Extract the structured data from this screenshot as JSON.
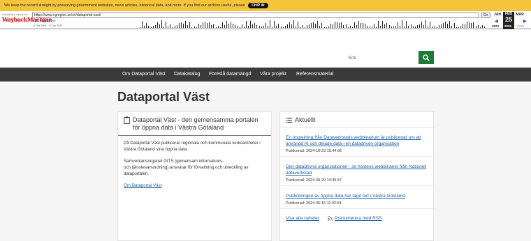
{
  "wayback": {
    "banner_text": "We keep the record straight by preserving government websites, news articles, historical data, and more. If you find our archive useful, please",
    "chip_label": "CHIP IN",
    "logo_top": "INTERNET ARCHIVE",
    "logo_main": "WaybackMachine",
    "url": "https://www.vgregion.se/ov/dataportal-vast/",
    "go_label": "Go",
    "captures": "787 captures",
    "date_range": "11 Okt 2009 – 27 Jun 2025",
    "months": [
      "JAN",
      "FEB",
      "MAR"
    ],
    "current_day": "25",
    "years": [
      "2023",
      "2025",
      "2026"
    ]
  },
  "header": {
    "search_placeholder": "Sök"
  },
  "nav": {
    "items": [
      {
        "label": "Om Dataportal Väst"
      },
      {
        "label": "Datakatalog"
      },
      {
        "label": "Föreslå datamängd"
      },
      {
        "label": "Våra projekt"
      },
      {
        "label": "Referensmaterial"
      }
    ]
  },
  "page": {
    "title": "Dataportal Väst"
  },
  "intro_card": {
    "heading": "Dataportal Väst - den gemensamma portalen för öppna data i Västra Götaland",
    "paragraph1": "På Dataportal Väst publicerar regionala och kommunala verksamheter i Västra Götaland sina öppna data.",
    "paragraph2_line1": "Samverkansorganet GITS (gemensam informations-",
    "paragraph2_line2": "och tjänstesamordning) ansvarar för förvaltning och utveckling av dataportalen.",
    "link": "Om Dataportal Väst"
  },
  "news_card": {
    "heading": "Aktuellt",
    "items": [
      {
        "title": "En Inspelning från Dataverkstads webbinarium är publicerad om att använda AI och delade data i en datadriven organisation",
        "date": "Publicerad: 2024-10-23 15:44:06"
      },
      {
        "title": "Den datadrivna organisationen - se höstens webbinarier från Nationell dataverkstad",
        "date": "Publicerad: 2024-09-20 14:35:57"
      },
      {
        "title": "Publiceringen av öppna data har tagit fart i Västra Götaland",
        "date": "Publicerad: 2024-05-16 11:02:54"
      }
    ],
    "see_all": "Visa alla nyheter",
    "rss": "Prenumerera med RSS"
  },
  "colors": {
    "banner": "#f6c43a",
    "nav_bg": "#3a3a3a",
    "search_button": "#1e7b36",
    "link": "#1a5fa8"
  }
}
